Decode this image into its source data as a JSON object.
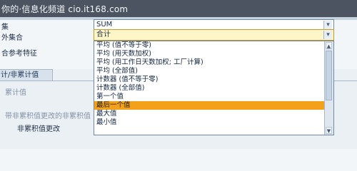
{
  "banner": {
    "watermark": "你的·信息化频道 cio.it168.com"
  },
  "form": {
    "row1_label": "集",
    "row1_value": "SUM",
    "row2_label": "外集合",
    "row2_value": "合计",
    "row3_label": "合参考特征"
  },
  "section": {
    "tab_label": "计/非累计值",
    "label_cumulative": "累计值",
    "label_non_cumulative_changes": "带非累积值更改的非累积值",
    "label_non_cumulative_change": "非累积值更改"
  },
  "dropdown": {
    "options": [
      "平均 (值不等于零)",
      "平均 (用天数加权)",
      "平均 (用工作日天数加权; 工厂计算)",
      "平均 (全部值)",
      "计数器 (值不等于零)",
      "计数器 (全部值)",
      "第一个值",
      "最后一个值",
      "最大值",
      "最小值"
    ],
    "selected": "最后一个值"
  },
  "icons": {
    "combo_button": "dropdown-arrow-icon",
    "scroll_up": "scroll-up-icon",
    "scroll_down": "scroll-down-icon"
  },
  "colors": {
    "highlight": "#f3a11a",
    "combo_active": "#fff6c8"
  }
}
